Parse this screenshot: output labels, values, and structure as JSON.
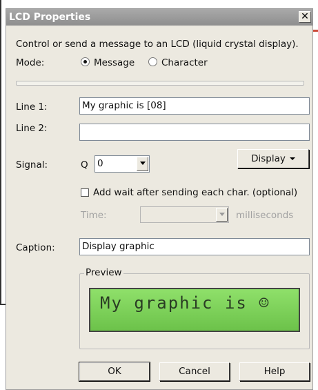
{
  "window": {
    "title": "LCD Properties",
    "close_glyph": "✕"
  },
  "description": "Control or send a message to an LCD (liquid crystal display).",
  "mode": {
    "label": "Mode:",
    "options": [
      "Message",
      "Character"
    ],
    "selected": "Message"
  },
  "line1": {
    "label": "Line 1:",
    "value": "My graphic is [08]"
  },
  "line2": {
    "label": "Line 2:",
    "value": ""
  },
  "signal": {
    "label": "Signal:",
    "prefix": "Q",
    "value": "0",
    "display_button": "Display"
  },
  "wait": {
    "checkbox_label": "Add wait after sending each char. (optional)",
    "checked": false,
    "time_label": "Time:",
    "time_value": "",
    "units": "milliseconds"
  },
  "caption": {
    "label": "Caption:",
    "value": "Display graphic"
  },
  "preview": {
    "label": "Preview",
    "lcd_text": "My graphic is ☺"
  },
  "buttons": {
    "ok": "OK",
    "cancel": "Cancel",
    "help": "Help"
  },
  "colors": {
    "dialog_bg": "#ece9e0",
    "titlebar": "#9b9b9b",
    "lcd_green": "#7fd25a",
    "lcd_text": "#2a3d24"
  }
}
